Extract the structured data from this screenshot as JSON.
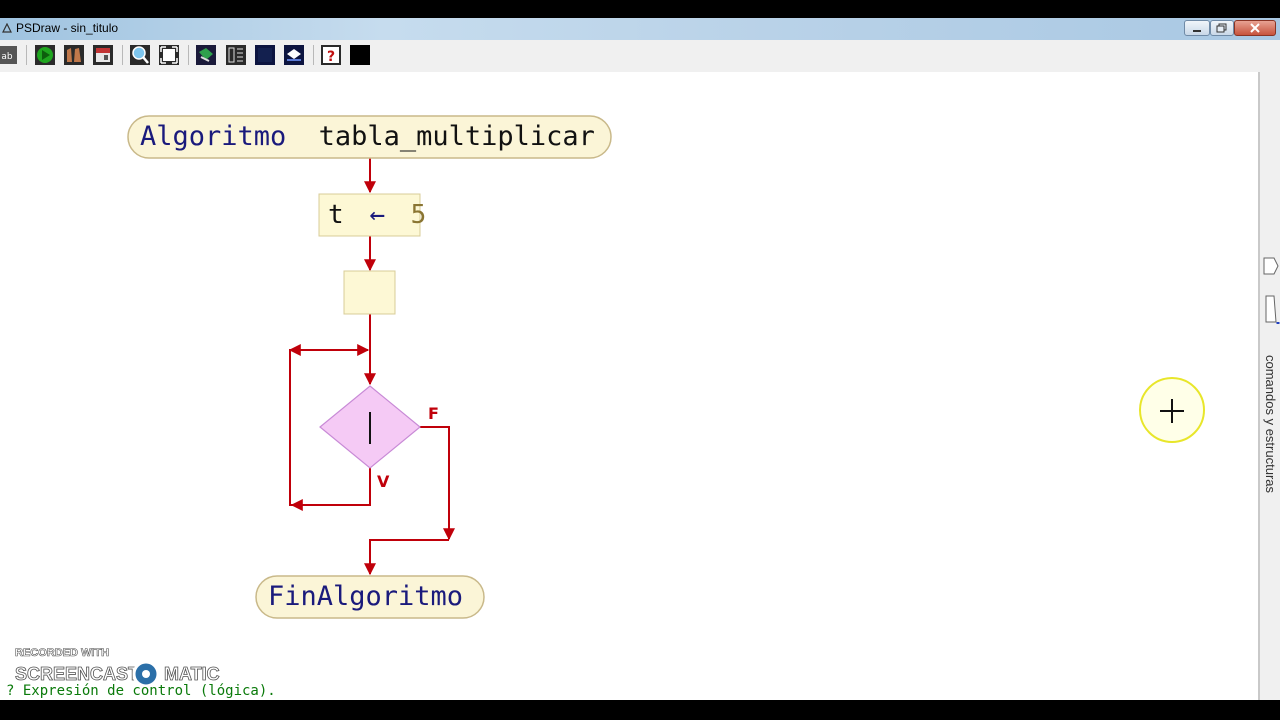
{
  "window": {
    "title": "PSDraw - sin_titulo",
    "buttons": [
      "minimize",
      "maximize",
      "close"
    ]
  },
  "toolbar": {
    "tools": [
      {
        "name": "new-file-icon"
      },
      {
        "name": "run-icon"
      },
      {
        "name": "step-icon"
      },
      {
        "name": "save-icon"
      },
      {
        "name": "zoom-icon"
      },
      {
        "name": "fit-view-icon"
      },
      {
        "name": "export-icon"
      },
      {
        "name": "structure-icon"
      },
      {
        "name": "dark-block-icon"
      },
      {
        "name": "pseudocode-icon"
      },
      {
        "name": "help-icon"
      },
      {
        "name": "black-square-icon"
      }
    ]
  },
  "diagram": {
    "start_keyword": "Algoritmo",
    "start_name": "tabla_multiplicar",
    "assign_var": "t",
    "assign_op": "←",
    "assign_value": "5",
    "false_label": "F",
    "true_label": "V",
    "end_label": "FinAlgoritmo",
    "colors": {
      "terminal_fill": "#fbf5d7",
      "terminal_stroke": "#c9b98a",
      "process_fill": "#fdf8d5",
      "diamond_fill": "#f5caf5",
      "diamond_stroke": "#c88ad6",
      "arrow": "#c0000a",
      "keyword": "#1a1a7c",
      "number": "#8a7532"
    }
  },
  "side_panel": {
    "label": "comandos y estructuras"
  },
  "status": {
    "text": "? Expresión de control (lógica)."
  },
  "watermark": {
    "line1": "RECORDED WITH",
    "brand_left": "SCREENCAST",
    "brand_right": "MATIC"
  }
}
